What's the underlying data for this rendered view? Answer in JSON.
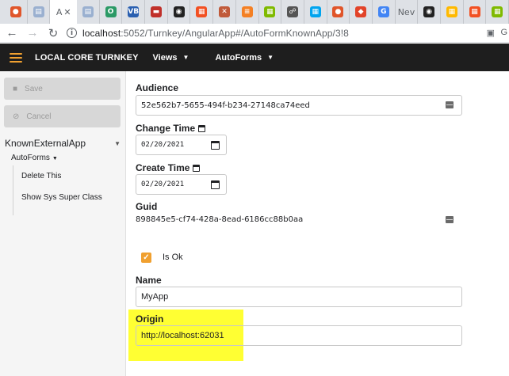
{
  "browser": {
    "tabs": [
      {
        "icon": "origin-favicon",
        "color": "#e0552a",
        "glyph": "●"
      },
      {
        "icon": "page-favicon",
        "color": "#9ab0d0",
        "glyph": "▤"
      },
      {
        "icon": "active-page-favicon",
        "color": "#ffffff",
        "glyph": "",
        "text": "A",
        "active": true
      },
      {
        "icon": "page-favicon",
        "color": "#9ab0d0",
        "glyph": "▤"
      },
      {
        "icon": "edge-favicon",
        "color": "#2b9a66",
        "glyph": "O"
      },
      {
        "icon": "vb-favicon",
        "color": "#2a5fb0",
        "glyph": "VB"
      },
      {
        "icon": "red-app-favicon",
        "color": "#c0302a",
        "glyph": "▬"
      },
      {
        "icon": "github-favicon",
        "color": "#222222",
        "glyph": "◉"
      },
      {
        "icon": "microsoft-favicon",
        "color": "#f25022",
        "glyph": "▦"
      },
      {
        "icon": "tools-favicon",
        "color": "#c05a3a",
        "glyph": "✕"
      },
      {
        "icon": "stackoverflow-favicon",
        "color": "#f48024",
        "glyph": "≡"
      },
      {
        "icon": "microsoft-favicon",
        "color": "#7fba00",
        "glyph": "▦"
      },
      {
        "icon": "chat-favicon",
        "color": "#555555",
        "glyph": "☍"
      },
      {
        "icon": "microsoft-favicon",
        "color": "#00a4ef",
        "glyph": "▦"
      },
      {
        "icon": "origin-favicon",
        "color": "#e0552a",
        "glyph": "●"
      },
      {
        "icon": "gitlab-favicon",
        "color": "#e24329",
        "glyph": "◆"
      },
      {
        "icon": "google-favicon",
        "color": "#4285f4",
        "glyph": "G"
      },
      {
        "icon": "new-tab-favicon",
        "color": "#ffffff",
        "glyph": "",
        "text": "Nev"
      },
      {
        "icon": "github-favicon",
        "color": "#222222",
        "glyph": "◉"
      },
      {
        "icon": "microsoft-favicon",
        "color": "#ffb900",
        "glyph": "▦"
      },
      {
        "icon": "microsoft-favicon",
        "color": "#f25022",
        "glyph": "▦"
      },
      {
        "icon": "microsoft-favicon",
        "color": "#7fba00",
        "glyph": "▦"
      }
    ],
    "url_host": "localhost",
    "url_rest": ":5052/Turnkey/AngularApp#/AutoFormKnownApp/3!8"
  },
  "appbar": {
    "brand": "LOCAL CORE TURNKEY",
    "menu_views": "Views",
    "menu_autoforms": "AutoForms",
    "accent": "#f0a030"
  },
  "sidebar": {
    "save_label": "Save",
    "cancel_label": "Cancel",
    "root_label": "KnownExternalApp",
    "sub_label": "AutoForms",
    "items": [
      "Delete This",
      "Show Sys Super Class"
    ]
  },
  "form": {
    "audience_label": "Audience",
    "audience_value": "52e562b7-5655-494f-b234-27148ca74eed",
    "change_time_label": "Change Time",
    "change_time_value": "02/20/2021",
    "create_time_label": "Create Time",
    "create_time_value": "02/20/2021",
    "guid_label": "Guid",
    "guid_value": "898845e5-cf74-428a-8ead-6186cc88b0aa",
    "is_ok_label": "Is Ok",
    "is_ok_checked": true,
    "name_label": "Name",
    "name_value": "MyApp",
    "origin_label": "Origin",
    "origin_value": "http://localhost:62031",
    "highlight_color": "#ffff33"
  }
}
